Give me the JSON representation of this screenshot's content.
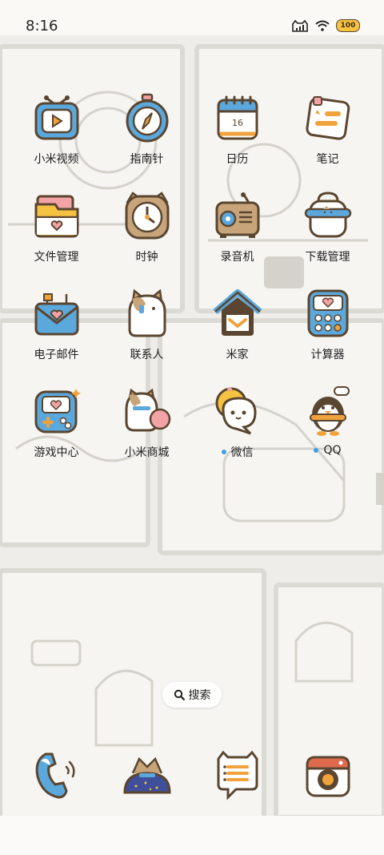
{
  "status_bar": {
    "time": "8:16",
    "battery": "100",
    "icons": [
      "cat-signal-icon",
      "wifi-icon",
      "battery-icon"
    ]
  },
  "apps": [
    [
      {
        "id": "xiaomi-video",
        "label": "小米视频",
        "icon": "tv-video-icon",
        "dot": false
      },
      {
        "id": "compass",
        "label": "指南针",
        "icon": "compass-icon",
        "dot": false
      },
      {
        "id": "calendar",
        "label": "日历",
        "icon": "calendar-icon",
        "date": "16",
        "dot": false
      },
      {
        "id": "notes",
        "label": "笔记",
        "icon": "notes-icon",
        "dot": false
      }
    ],
    [
      {
        "id": "file-manager",
        "label": "文件管理",
        "icon": "folder-icon",
        "dot": false
      },
      {
        "id": "clock",
        "label": "时钟",
        "icon": "clock-icon",
        "dot": false
      },
      {
        "id": "recorder",
        "label": "录音机",
        "icon": "radio-recorder-icon",
        "dot": false
      },
      {
        "id": "downloads",
        "label": "下载管理",
        "icon": "download-icon",
        "dot": false
      }
    ],
    [
      {
        "id": "email",
        "label": "电子邮件",
        "icon": "mail-icon",
        "dot": false
      },
      {
        "id": "contacts",
        "label": "联系人",
        "icon": "cat-contact-icon",
        "dot": false
      },
      {
        "id": "mijia",
        "label": "米家",
        "icon": "home-icon",
        "dot": false
      },
      {
        "id": "calculator",
        "label": "计算器",
        "icon": "calculator-icon",
        "dot": false
      }
    ],
    [
      {
        "id": "game-center",
        "label": "游戏中心",
        "icon": "gamepad-icon",
        "dot": false
      },
      {
        "id": "mi-store",
        "label": "小米商城",
        "icon": "cat-store-icon",
        "dot": false
      },
      {
        "id": "wechat",
        "label": "微信",
        "icon": "wechat-bubble-icon",
        "dot": true
      },
      {
        "id": "qq",
        "label": "QQ",
        "icon": "penguin-icon",
        "dot": true
      }
    ]
  ],
  "search": {
    "label": "搜索",
    "icon": "search-icon"
  },
  "dock": [
    {
      "id": "phone",
      "icon": "phone-icon"
    },
    {
      "id": "messages-cat",
      "icon": "cat-dock-icon"
    },
    {
      "id": "messages",
      "icon": "message-bubble-icon"
    },
    {
      "id": "camera",
      "icon": "camera-icon"
    }
  ],
  "colors": {
    "accent_dot": "#3ea0e0",
    "icon_outline": "#5a4630",
    "blue": "#5ba8dc",
    "orange": "#f0a33c",
    "pink": "#f3a2a6"
  }
}
